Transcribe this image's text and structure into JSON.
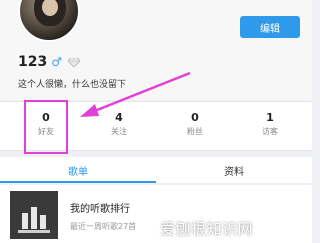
{
  "profile": {
    "username": "123",
    "gender_icon": "male-icon",
    "gender_symbol": "♂",
    "badge_icon": "diamond-icon",
    "signature": "这个人很懒，什么也没留下",
    "edit_label": "编辑"
  },
  "stats": [
    {
      "value": "0",
      "label": "好友"
    },
    {
      "value": "4",
      "label": "关注"
    },
    {
      "value": "0",
      "label": "粉丝"
    },
    {
      "value": "1",
      "label": "访客"
    }
  ],
  "tabs": [
    {
      "label": "歌单",
      "active": true
    },
    {
      "label": "资料",
      "active": false
    }
  ],
  "playlist": [
    {
      "title": "我的听歌排行",
      "subtitle": "最近一周听歌27首"
    }
  ],
  "watermark": "爱刨根知识网",
  "colors": {
    "accent": "#2f9ae9",
    "highlight": "#e040d8"
  }
}
